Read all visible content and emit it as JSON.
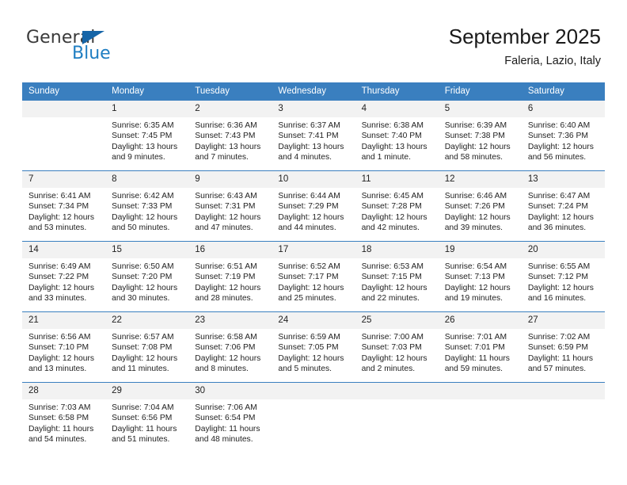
{
  "brand": {
    "name_top": "General",
    "name_bottom": "Blue",
    "logo_color": "#1565a8",
    "text_color": "#3a3a3a",
    "blue_color": "#1f7ec2"
  },
  "header": {
    "title": "September 2025",
    "subtitle": "Faleria, Lazio, Italy"
  },
  "theme": {
    "header_bar": "#3a7fbf",
    "daynum_bg": "#f2f2f2",
    "text": "#222222"
  },
  "weekdays": [
    "Sunday",
    "Monday",
    "Tuesday",
    "Wednesday",
    "Thursday",
    "Friday",
    "Saturday"
  ],
  "weeks": [
    [
      {
        "day": "",
        "sunrise": "",
        "sunset": "",
        "daylight1": "",
        "daylight2": ""
      },
      {
        "day": "1",
        "sunrise": "Sunrise: 6:35 AM",
        "sunset": "Sunset: 7:45 PM",
        "daylight1": "Daylight: 13 hours",
        "daylight2": "and 9 minutes."
      },
      {
        "day": "2",
        "sunrise": "Sunrise: 6:36 AM",
        "sunset": "Sunset: 7:43 PM",
        "daylight1": "Daylight: 13 hours",
        "daylight2": "and 7 minutes."
      },
      {
        "day": "3",
        "sunrise": "Sunrise: 6:37 AM",
        "sunset": "Sunset: 7:41 PM",
        "daylight1": "Daylight: 13 hours",
        "daylight2": "and 4 minutes."
      },
      {
        "day": "4",
        "sunrise": "Sunrise: 6:38 AM",
        "sunset": "Sunset: 7:40 PM",
        "daylight1": "Daylight: 13 hours",
        "daylight2": "and 1 minute."
      },
      {
        "day": "5",
        "sunrise": "Sunrise: 6:39 AM",
        "sunset": "Sunset: 7:38 PM",
        "daylight1": "Daylight: 12 hours",
        "daylight2": "and 58 minutes."
      },
      {
        "day": "6",
        "sunrise": "Sunrise: 6:40 AM",
        "sunset": "Sunset: 7:36 PM",
        "daylight1": "Daylight: 12 hours",
        "daylight2": "and 56 minutes."
      }
    ],
    [
      {
        "day": "7",
        "sunrise": "Sunrise: 6:41 AM",
        "sunset": "Sunset: 7:34 PM",
        "daylight1": "Daylight: 12 hours",
        "daylight2": "and 53 minutes."
      },
      {
        "day": "8",
        "sunrise": "Sunrise: 6:42 AM",
        "sunset": "Sunset: 7:33 PM",
        "daylight1": "Daylight: 12 hours",
        "daylight2": "and 50 minutes."
      },
      {
        "day": "9",
        "sunrise": "Sunrise: 6:43 AM",
        "sunset": "Sunset: 7:31 PM",
        "daylight1": "Daylight: 12 hours",
        "daylight2": "and 47 minutes."
      },
      {
        "day": "10",
        "sunrise": "Sunrise: 6:44 AM",
        "sunset": "Sunset: 7:29 PM",
        "daylight1": "Daylight: 12 hours",
        "daylight2": "and 44 minutes."
      },
      {
        "day": "11",
        "sunrise": "Sunrise: 6:45 AM",
        "sunset": "Sunset: 7:28 PM",
        "daylight1": "Daylight: 12 hours",
        "daylight2": "and 42 minutes."
      },
      {
        "day": "12",
        "sunrise": "Sunrise: 6:46 AM",
        "sunset": "Sunset: 7:26 PM",
        "daylight1": "Daylight: 12 hours",
        "daylight2": "and 39 minutes."
      },
      {
        "day": "13",
        "sunrise": "Sunrise: 6:47 AM",
        "sunset": "Sunset: 7:24 PM",
        "daylight1": "Daylight: 12 hours",
        "daylight2": "and 36 minutes."
      }
    ],
    [
      {
        "day": "14",
        "sunrise": "Sunrise: 6:49 AM",
        "sunset": "Sunset: 7:22 PM",
        "daylight1": "Daylight: 12 hours",
        "daylight2": "and 33 minutes."
      },
      {
        "day": "15",
        "sunrise": "Sunrise: 6:50 AM",
        "sunset": "Sunset: 7:20 PM",
        "daylight1": "Daylight: 12 hours",
        "daylight2": "and 30 minutes."
      },
      {
        "day": "16",
        "sunrise": "Sunrise: 6:51 AM",
        "sunset": "Sunset: 7:19 PM",
        "daylight1": "Daylight: 12 hours",
        "daylight2": "and 28 minutes."
      },
      {
        "day": "17",
        "sunrise": "Sunrise: 6:52 AM",
        "sunset": "Sunset: 7:17 PM",
        "daylight1": "Daylight: 12 hours",
        "daylight2": "and 25 minutes."
      },
      {
        "day": "18",
        "sunrise": "Sunrise: 6:53 AM",
        "sunset": "Sunset: 7:15 PM",
        "daylight1": "Daylight: 12 hours",
        "daylight2": "and 22 minutes."
      },
      {
        "day": "19",
        "sunrise": "Sunrise: 6:54 AM",
        "sunset": "Sunset: 7:13 PM",
        "daylight1": "Daylight: 12 hours",
        "daylight2": "and 19 minutes."
      },
      {
        "day": "20",
        "sunrise": "Sunrise: 6:55 AM",
        "sunset": "Sunset: 7:12 PM",
        "daylight1": "Daylight: 12 hours",
        "daylight2": "and 16 minutes."
      }
    ],
    [
      {
        "day": "21",
        "sunrise": "Sunrise: 6:56 AM",
        "sunset": "Sunset: 7:10 PM",
        "daylight1": "Daylight: 12 hours",
        "daylight2": "and 13 minutes."
      },
      {
        "day": "22",
        "sunrise": "Sunrise: 6:57 AM",
        "sunset": "Sunset: 7:08 PM",
        "daylight1": "Daylight: 12 hours",
        "daylight2": "and 11 minutes."
      },
      {
        "day": "23",
        "sunrise": "Sunrise: 6:58 AM",
        "sunset": "Sunset: 7:06 PM",
        "daylight1": "Daylight: 12 hours",
        "daylight2": "and 8 minutes."
      },
      {
        "day": "24",
        "sunrise": "Sunrise: 6:59 AM",
        "sunset": "Sunset: 7:05 PM",
        "daylight1": "Daylight: 12 hours",
        "daylight2": "and 5 minutes."
      },
      {
        "day": "25",
        "sunrise": "Sunrise: 7:00 AM",
        "sunset": "Sunset: 7:03 PM",
        "daylight1": "Daylight: 12 hours",
        "daylight2": "and 2 minutes."
      },
      {
        "day": "26",
        "sunrise": "Sunrise: 7:01 AM",
        "sunset": "Sunset: 7:01 PM",
        "daylight1": "Daylight: 11 hours",
        "daylight2": "and 59 minutes."
      },
      {
        "day": "27",
        "sunrise": "Sunrise: 7:02 AM",
        "sunset": "Sunset: 6:59 PM",
        "daylight1": "Daylight: 11 hours",
        "daylight2": "and 57 minutes."
      }
    ],
    [
      {
        "day": "28",
        "sunrise": "Sunrise: 7:03 AM",
        "sunset": "Sunset: 6:58 PM",
        "daylight1": "Daylight: 11 hours",
        "daylight2": "and 54 minutes."
      },
      {
        "day": "29",
        "sunrise": "Sunrise: 7:04 AM",
        "sunset": "Sunset: 6:56 PM",
        "daylight1": "Daylight: 11 hours",
        "daylight2": "and 51 minutes."
      },
      {
        "day": "30",
        "sunrise": "Sunrise: 7:06 AM",
        "sunset": "Sunset: 6:54 PM",
        "daylight1": "Daylight: 11 hours",
        "daylight2": "and 48 minutes."
      },
      {
        "day": "",
        "sunrise": "",
        "sunset": "",
        "daylight1": "",
        "daylight2": ""
      },
      {
        "day": "",
        "sunrise": "",
        "sunset": "",
        "daylight1": "",
        "daylight2": ""
      },
      {
        "day": "",
        "sunrise": "",
        "sunset": "",
        "daylight1": "",
        "daylight2": ""
      },
      {
        "day": "",
        "sunrise": "",
        "sunset": "",
        "daylight1": "",
        "daylight2": ""
      }
    ]
  ]
}
